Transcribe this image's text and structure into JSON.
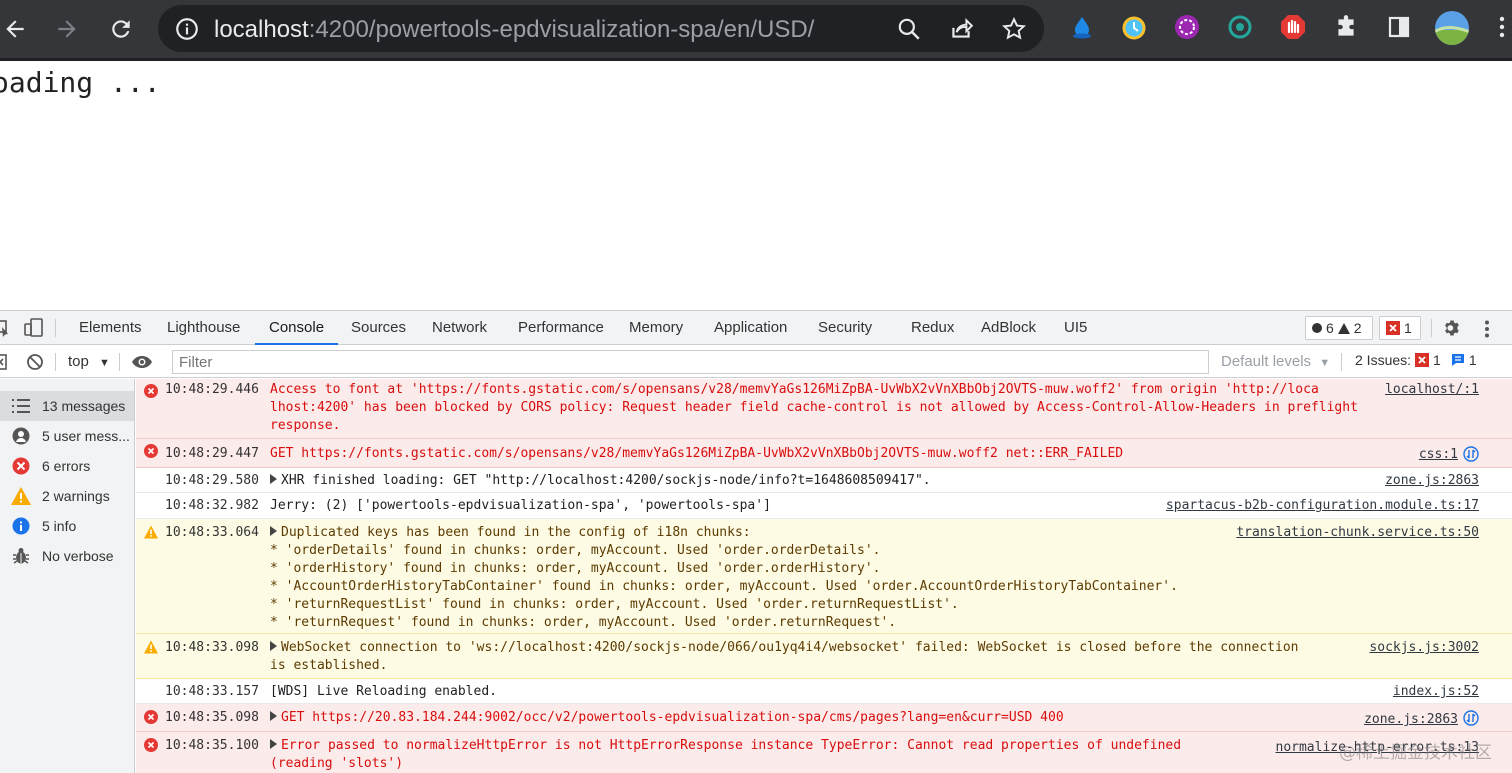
{
  "browser": {
    "url_host": "localhost",
    "url_path": ":4200/powertools-epdvisualization-spa/en/USD/",
    "nav_icons": [
      "back-icon",
      "forward-icon",
      "reload-icon"
    ],
    "omnibox_icons": [
      "info-icon",
      "zoom-icon",
      "share-icon",
      "star-icon"
    ],
    "extensions": [
      "extension-blue-drop-icon",
      "extension-clock-icon",
      "extension-purple-icon",
      "extension-teal-eye-icon",
      "extension-adblock-hand-icon",
      "puzzle-icon",
      "side-panel-icon",
      "profile-avatar-icon",
      "more-icon"
    ]
  },
  "page": {
    "text": "oading ..."
  },
  "devtools": {
    "tabs": [
      "Elements",
      "Lighthouse",
      "Console",
      "Sources",
      "Network",
      "Performance",
      "Memory",
      "Application",
      "Security",
      "Redux",
      "AdBlock",
      "UI5"
    ],
    "active_tab": "Console",
    "counters": {
      "errors": "6",
      "warnings": "2",
      "issues": "1"
    },
    "toolbar": {
      "context": "top",
      "filter_placeholder": "Filter",
      "levels": "Default levels",
      "issues_label": "2 Issues:",
      "issues_errors": "1",
      "issues_info": "1"
    },
    "sidebar": [
      {
        "label": "13 messages",
        "icon": "list-icon"
      },
      {
        "label": "5 user mess...",
        "icon": "user-icon"
      },
      {
        "label": "6 errors",
        "icon": "error-icon"
      },
      {
        "label": "2 warnings",
        "icon": "warning-icon"
      },
      {
        "label": "5 info",
        "icon": "info-icon"
      },
      {
        "label": "No verbose",
        "icon": "bug-icon"
      }
    ],
    "messages": [
      {
        "level": "error",
        "time": "10:48:29.446",
        "lines": [
          "Access to font at 'https://fonts.gstatic.com/s/opensans/v28/memvYaGs126MiZpBA-UvWbX2vVnXBbObj2OVTS-muw.woff2' from origin 'http://loca",
          "lhost:4200' has been blocked by CORS policy: Request header field cache-control is not allowed by Access-Control-Allow-Headers in preflight",
          "response."
        ],
        "source": "localhost/:1"
      },
      {
        "level": "error",
        "time": "10:48:29.447",
        "lines": [
          "GET https://fonts.gstatic.com/s/opensans/v28/memvYaGs126MiZpBA-UvWbX2vVnXBbObj2OVTS-muw.woff2 net::ERR_FAILED"
        ],
        "source": "css:1"
      },
      {
        "level": "log",
        "time": "10:48:29.580",
        "lines": [
          "XHR finished loading: GET \"http://localhost:4200/sockjs-node/info?t=1648608509417\"."
        ],
        "source": "zone.js:2863"
      },
      {
        "level": "log",
        "time": "10:48:32.982",
        "lines": [
          "Jerry: (2) ['powertools-epdvisualization-spa', 'powertools-spa']"
        ],
        "source": "spartacus-b2b-configuration.module.ts:17"
      },
      {
        "level": "warning",
        "time": "10:48:33.064",
        "lines": [
          "Duplicated keys has been found in the config of i18n chunks:",
          "* 'orderDetails' found in chunks: order, myAccount. Used 'order.orderDetails'.",
          "* 'orderHistory' found in chunks: order, myAccount. Used 'order.orderHistory'.",
          "* 'AccountOrderHistoryTabContainer' found in chunks: order, myAccount. Used 'order.AccountOrderHistoryTabContainer'.",
          "* 'returnRequestList' found in chunks: order, myAccount. Used 'order.returnRequestList'.",
          "* 'returnRequest' found in chunks: order, myAccount. Used 'order.returnRequest'."
        ],
        "source": "translation-chunk.service.ts:50"
      },
      {
        "level": "warning",
        "time": "10:48:33.098",
        "lines": [
          "WebSocket connection to 'ws://localhost:4200/sockjs-node/066/ou1yq4i4/websocket' failed: WebSocket is closed before the connection",
          "is established."
        ],
        "source": "sockjs.js:3002"
      },
      {
        "level": "log",
        "time": "10:48:33.157",
        "lines": [
          "[WDS] Live Reloading enabled."
        ],
        "source": "index.js:52"
      },
      {
        "level": "error",
        "time": "10:48:35.098",
        "lines": [
          "GET https://20.83.184.244:9002/occ/v2/powertools-epdvisualization-spa/cms/pages?lang=en&curr=USD 400"
        ],
        "source": "zone.js:2863"
      },
      {
        "level": "error",
        "time": "10:48:35.100",
        "lines": [
          "Error passed to normalizeHttpError is not HttpErrorResponse instance TypeError: Cannot read properties of undefined",
          "(reading 'slots')"
        ],
        "source": "normalize-http-error.ts:13"
      }
    ]
  },
  "watermark": "@稀土掘金技术社区",
  "colors": {
    "chrome_bg": "#35363a",
    "omnibox_bg": "#202124",
    "error_bg": "#fcebeb",
    "error_text": "#d80e0e",
    "warning_bg": "#fefbe5",
    "active_tab_underline": "#1a73e8"
  }
}
